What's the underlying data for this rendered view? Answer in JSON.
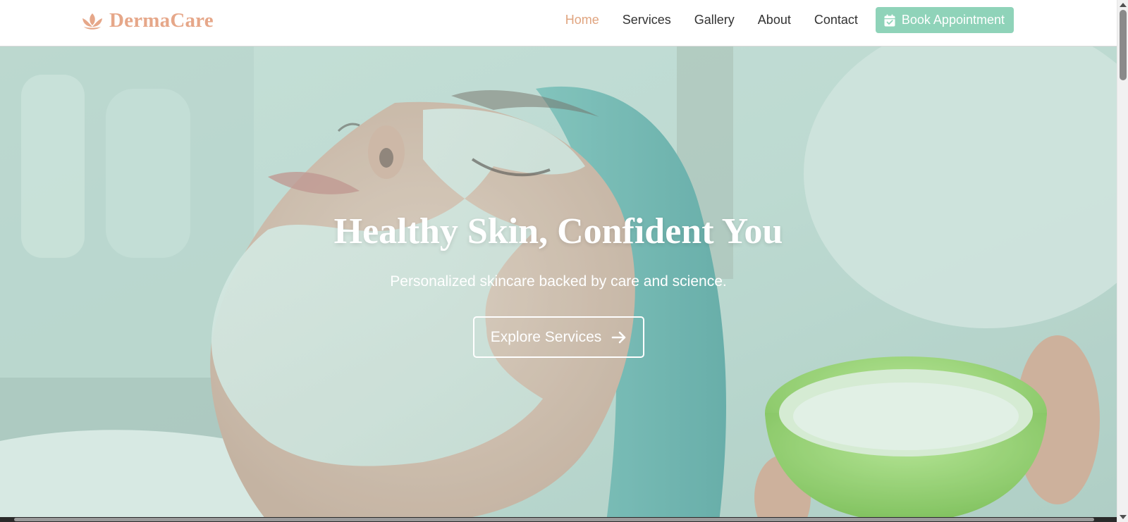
{
  "brand": {
    "name": "DermaCare",
    "icon": "lotus-icon",
    "color": "#e6a789"
  },
  "nav": {
    "links": [
      {
        "label": "Home",
        "active": true
      },
      {
        "label": "Services",
        "active": false
      },
      {
        "label": "Gallery",
        "active": false
      },
      {
        "label": "About",
        "active": false
      },
      {
        "label": "Contact",
        "active": false
      }
    ],
    "cta": {
      "label": "Book Appointment",
      "icon": "calendar-check-icon",
      "color": "#8fd3b9"
    },
    "active_color": "#e0a47f"
  },
  "hero": {
    "title": "Healthy Skin, Confident You",
    "subtitle": "Personalized skincare backed by care and science.",
    "button": {
      "label": "Explore Services",
      "icon": "arrow-right-icon"
    },
    "background": "facial-treatment-photo"
  }
}
